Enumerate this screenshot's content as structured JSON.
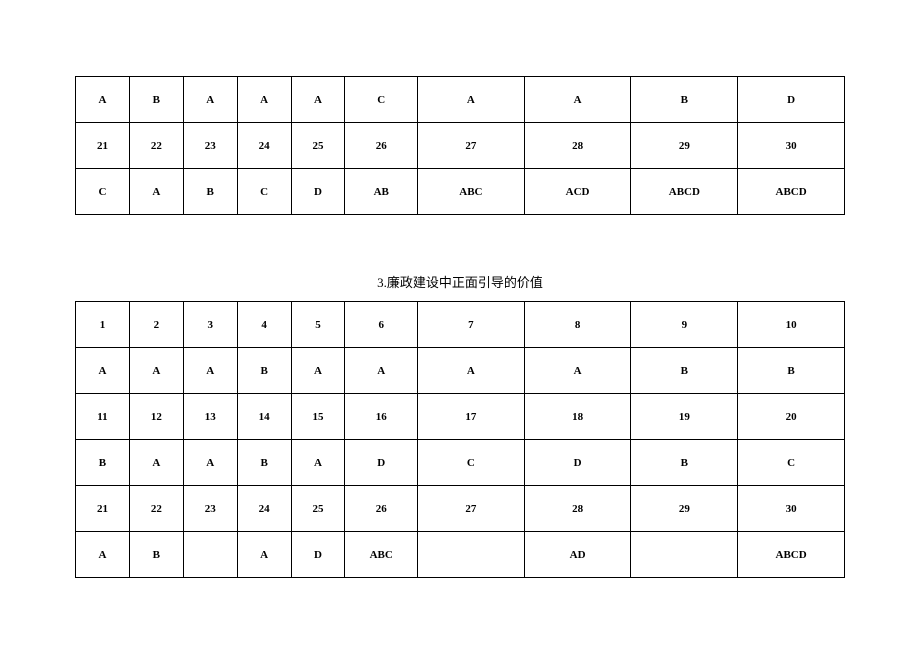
{
  "chart_data": [
    {
      "type": "table",
      "title": "",
      "rows": [
        [
          "A",
          "B",
          "A",
          "A",
          "A",
          "C",
          "A",
          "A",
          "B",
          "D"
        ],
        [
          "21",
          "22",
          "23",
          "24",
          "25",
          "26",
          "27",
          "28",
          "29",
          "30"
        ],
        [
          "C",
          "A",
          "B",
          "C",
          "D",
          "AB",
          "ABC",
          "ACD",
          "ABCD",
          "ABCD"
        ]
      ]
    },
    {
      "type": "table",
      "title": "3.廉政建设中正面引导的价值",
      "rows": [
        [
          "1",
          "2",
          "3",
          "4",
          "5",
          "6",
          "7",
          "8",
          "9",
          "10"
        ],
        [
          "A",
          "A",
          "A",
          "B",
          "A",
          "A",
          "A",
          "A",
          "B",
          "B"
        ],
        [
          "11",
          "12",
          "13",
          "14",
          "15",
          "16",
          "17",
          "18",
          "19",
          "20"
        ],
        [
          "B",
          "A",
          "A",
          "B",
          "A",
          "D",
          "C",
          "D",
          "B",
          "C"
        ],
        [
          "21",
          "22",
          "23",
          "24",
          "25",
          "26",
          "27",
          "28",
          "29",
          "30"
        ],
        [
          "A",
          "B",
          "",
          "A",
          "D",
          "ABC",
          "",
          "AD",
          "",
          "ABCD"
        ]
      ]
    }
  ]
}
